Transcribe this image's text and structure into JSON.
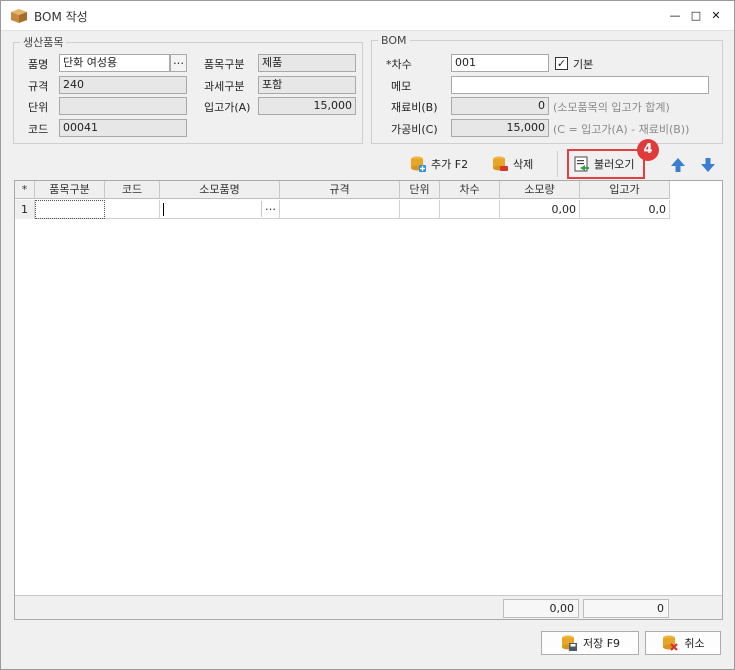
{
  "window": {
    "title": "BOM 작성",
    "min_glyph": "—",
    "max_glyph": "□",
    "close_glyph": "✕"
  },
  "product_group": {
    "legend": "생산품목",
    "name_label": "품명",
    "name_value": "단화 여성용",
    "spec_label": "규격",
    "spec_value": "240",
    "unit_label": "단위",
    "unit_value": "",
    "code_label": "코드",
    "code_value": "00041",
    "category_label": "품목구분",
    "category_value": "제품",
    "tax_label": "과세구분",
    "tax_value": "포함",
    "inprice_label": "입고가(A)",
    "inprice_value": "15,000"
  },
  "bom_group": {
    "legend": "BOM",
    "revision_label": "*차수",
    "revision_value": "001",
    "default_label": "기본",
    "default_checked": "✓",
    "memo_label": "메모",
    "memo_value": "",
    "material_label": "재료비(B)",
    "material_value": "0",
    "material_hint": "(소모품목의 입고가 합계)",
    "process_label": "가공비(C)",
    "process_value": "15,000",
    "process_hint": "(C = 입고가(A) - 재료비(B))"
  },
  "toolbar": {
    "add_label": "추가 F2",
    "delete_label": "삭제",
    "load_label": "불러오기",
    "step_badge": "4"
  },
  "grid": {
    "columns": [
      "*",
      "품목구분",
      "코드",
      "소모품명",
      "규격",
      "단위",
      "차수",
      "소모량",
      "입고가"
    ],
    "rows": [
      {
        "no": "1",
        "category": "",
        "code": "",
        "name": "",
        "spec": "",
        "unit": "",
        "revision": "",
        "qty": "0,00",
        "price": "0,0"
      }
    ],
    "sum_qty": "0,00",
    "sum_price": "0"
  },
  "buttons": {
    "save_label": "저장 F9",
    "cancel_label": "취소"
  },
  "colors": {
    "accent_blue": "#3a7fcf",
    "highlight_red": "#e0403f"
  }
}
